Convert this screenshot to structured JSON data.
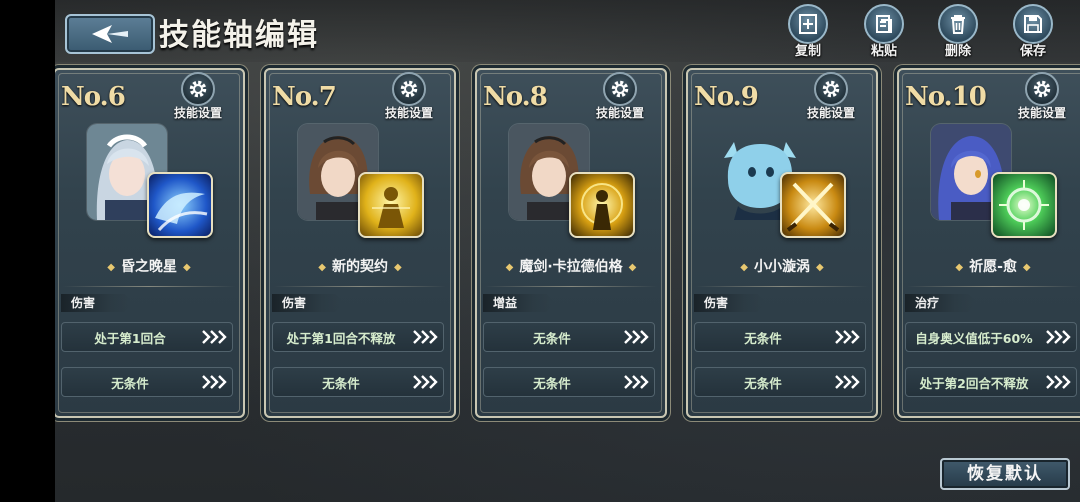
{
  "header": {
    "title": "技能轴编辑",
    "tools": [
      {
        "label": "复制",
        "icon": "copy-icon"
      },
      {
        "label": "粘贴",
        "icon": "paste-icon"
      },
      {
        "label": "删除",
        "icon": "trash-icon"
      },
      {
        "label": "保存",
        "icon": "save-icon"
      }
    ]
  },
  "cards": [
    {
      "number": "No.6",
      "settings_label": "技能设置",
      "skill_name": "昏之晚星",
      "type": "伤害",
      "cond1": "处于第1回合",
      "cond2": "无条件",
      "character": "silver-haired-maid",
      "skill_icon": "blue-wave-icon"
    },
    {
      "number": "No.7",
      "settings_label": "技能设置",
      "skill_name": "新的契约",
      "type": "伤害",
      "cond1": "处于第1回合不释放",
      "cond2": "无条件",
      "character": "brown-haired-youth",
      "skill_icon": "golden-figure-icon"
    },
    {
      "number": "No.8",
      "settings_label": "技能设置",
      "skill_name": "魔剑·卡拉德伯格",
      "type": "增益",
      "cond1": "无条件",
      "cond2": "无条件",
      "character": "brown-haired-youth",
      "skill_icon": "golden-aura-icon"
    },
    {
      "number": "No.9",
      "settings_label": "技能设置",
      "skill_name": "小小漩涡",
      "type": "伤害",
      "cond1": "无条件",
      "cond2": "无条件",
      "character": "blue-ghost-fish",
      "skill_icon": "crossed-swords-icon"
    },
    {
      "number": "No.10",
      "settings_label": "技能设置",
      "skill_name": "祈愿-愈",
      "type": "治疗",
      "cond1": "自身奥义值低于60%",
      "cond2": "处于第2回合不释放",
      "character": "blue-haired-girl",
      "skill_icon": "green-orb-icon"
    }
  ],
  "footer": {
    "restore_label": "恢复默认"
  },
  "colors": {
    "accent_gold": "#f0dca6",
    "card_border": "#c9c7b3",
    "condition_text": "#d6eccd"
  }
}
